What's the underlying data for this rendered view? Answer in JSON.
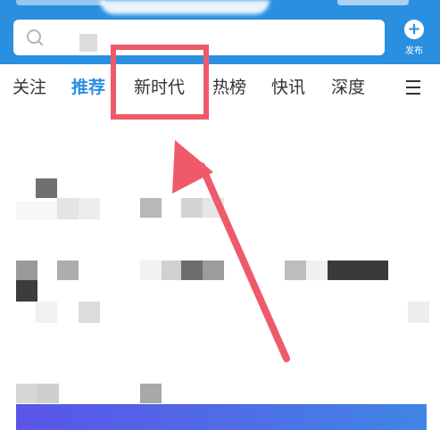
{
  "header": {
    "search": {
      "placeholder": ""
    },
    "publish": {
      "label": "发布"
    }
  },
  "tabs": [
    {
      "label": "关注",
      "active": false
    },
    {
      "label": "推荐",
      "active": true
    },
    {
      "label": "新时代",
      "active": false
    },
    {
      "label": "热榜",
      "active": false
    },
    {
      "label": "快讯",
      "active": false
    },
    {
      "label": "深度",
      "active": false
    }
  ],
  "icons": {
    "search": "search-icon",
    "publish": "plus-icon",
    "menu": "menu-icon"
  },
  "colors": {
    "header_bg": "#2b8fe0",
    "active_tab": "#2b8fe0",
    "tab_text": "#333333",
    "annotation": "#ef5a6a"
  }
}
